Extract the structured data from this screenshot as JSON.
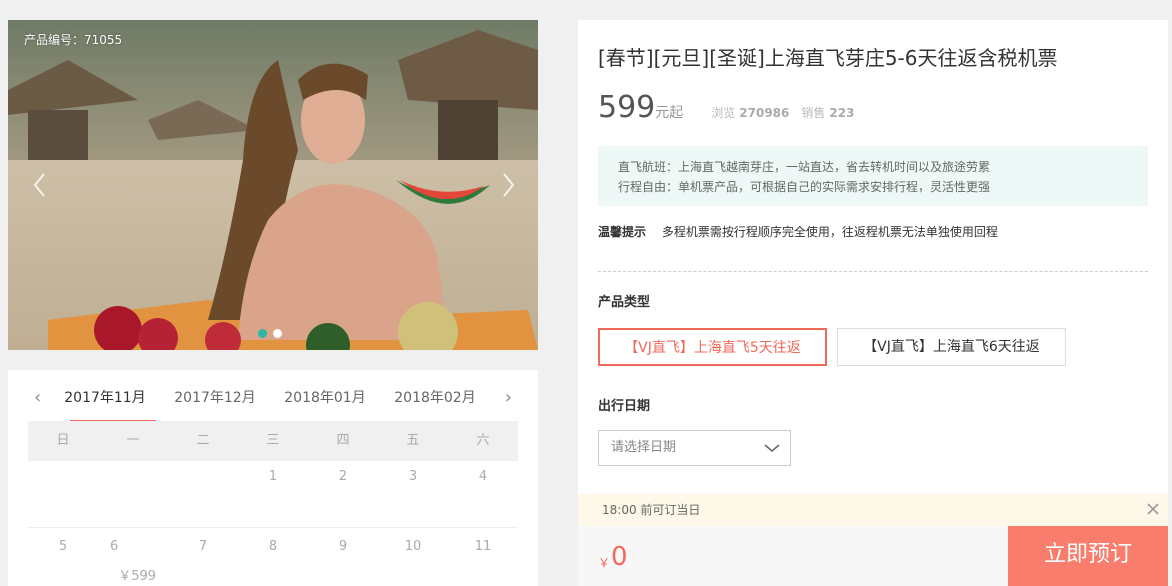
{
  "carousel": {
    "product_id_label": "产品编号：71055",
    "prev_icon": "chevron-left-icon",
    "next_icon": "chevron-right-icon",
    "slides": 2,
    "active_slide": 1,
    "accent": "#2bb7a3"
  },
  "calendar": {
    "prev_label": "‹",
    "next_label": "›",
    "months": [
      "2017年11月",
      "2017年12月",
      "2018年01月",
      "2018年02月"
    ],
    "active_month": 0,
    "weekdays": [
      "日",
      "一",
      "二",
      "三",
      "四",
      "五",
      "六"
    ],
    "row1": [
      "",
      "",
      "",
      "1",
      "2",
      "3",
      "4"
    ],
    "row2": [
      "5",
      "6",
      "7",
      "8",
      "9",
      "10",
      "11"
    ],
    "row2_price": "￥599",
    "row2_price_day": "6"
  },
  "product": {
    "title": "[春节][元旦][圣诞]上海直飞芽庄5-6天往返含税机票",
    "price": "599",
    "price_unit": "元起",
    "views_label": "浏览",
    "views": "270986",
    "sales_label": "销售",
    "sales": "223",
    "highlights": [
      "直飞航班：上海直飞越南芽庄，一站直达，省去转机时间以及旅途劳累",
      "行程自由：单机票产品，可根据自己的实际需求安排行程，灵活性更强"
    ],
    "notice_label": "温馨提示",
    "notice_text": "多程机票需按行程顺序完全使用，往返程机票无法单独使用回程",
    "type_label": "产品类型",
    "types": [
      "【VJ直飞】上海直飞5天往返",
      "【VJ直飞】上海直飞6天往返"
    ],
    "selected_type": 0,
    "date_label": "出行日期",
    "date_placeholder": "请选择日期",
    "tip": "18:00 前可订当日",
    "total_currency": "￥",
    "total": "0",
    "book_label": "立即预订",
    "accent": "#f0695a",
    "book_color": "#f87d6d"
  }
}
